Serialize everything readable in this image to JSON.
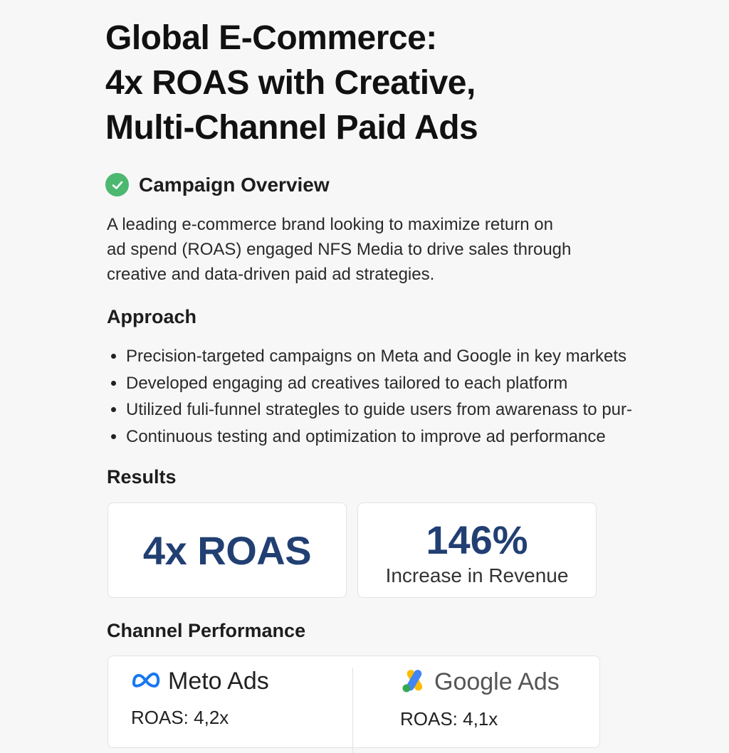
{
  "title": {
    "line1": "Global E-Commerce:",
    "line2": "4x ROAS with Creative,",
    "line3": "Multi-Channel Paid Ads"
  },
  "overview": {
    "heading": "Campaign Overview",
    "line1": "A leading e-commerce brand looking to maximize return on",
    "line2": "ad spend (ROAS) engaged NFS Media to drive sales through",
    "line3": "creative and data-driven paid ad strategies."
  },
  "approach": {
    "heading": "Approach",
    "items": [
      "Precision-targeted campaigns on Meta and Google in key markets",
      "Developed engaging ad creatives tailored to each platform",
      "Utilized fuli-funnel strategles to guide users from awarenass to pur-",
      "Continuous testing and optimization to improve ad performance"
    ]
  },
  "results": {
    "heading": "Results",
    "roas": "4x ROAS",
    "revenue_value": "146%",
    "revenue_label": "Increase in Revenue"
  },
  "channels": {
    "heading": "Channel Performance",
    "meta": {
      "name": "Meto Ads",
      "roas": "ROAS: 4,2x",
      "icon": "meta-logo-icon"
    },
    "google": {
      "name": "Google Ads",
      "roas": "ROAS: 4,1x",
      "icon": "google-ads-logo-icon"
    }
  },
  "colors": {
    "accent_navy": "#213f72",
    "check_green": "#4cb870",
    "meta_blue": "#1877f2"
  }
}
